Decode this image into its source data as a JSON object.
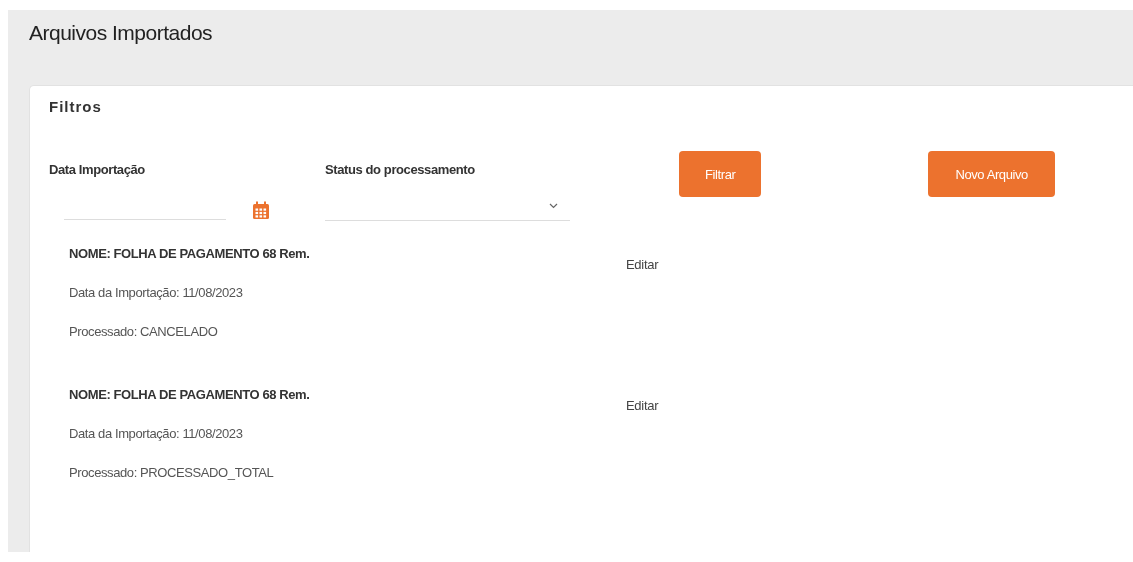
{
  "page_title": "Arquivos Importados",
  "filters": {
    "title": "Filtros",
    "date_label": "Data Importação",
    "status_label": "Status do processamento",
    "buttons": [
      "Filtrar",
      "Novo Arquivo"
    ]
  },
  "files": [
    {
      "name": "NOME: FOLHA DE PAGAMENTO 68 Rem.",
      "import_date": "Data da Importação: 11/08/2023",
      "status": "Processado: CANCELADO",
      "action": "Editar"
    },
    {
      "name": "NOME: FOLHA DE PAGAMENTO 68 Rem.",
      "import_date": "Data da Importação: 11/08/2023",
      "status": "Processado: PROCESSADO_TOTAL",
      "action": "Editar"
    }
  ]
}
